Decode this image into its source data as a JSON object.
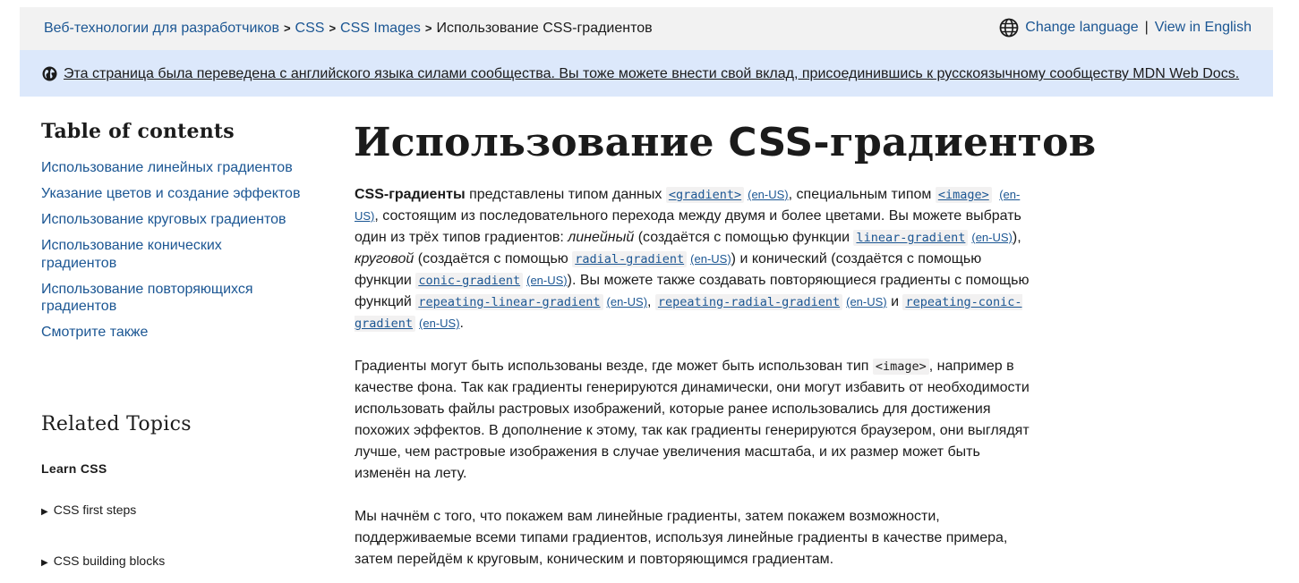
{
  "breadcrumbs": {
    "items": [
      "Веб-технологии для разработчиков",
      "CSS",
      "CSS Images"
    ],
    "current": "Использование CSS-градиентов",
    "separator": ">"
  },
  "language": {
    "change_label": "Change language",
    "divider": "|",
    "view_english": "View in English"
  },
  "notice": {
    "text": "Эта страница была переведена с английского языка силами сообщества. Вы тоже можете внести свой вклад, присоединившись к русскоязычному сообществу MDN Web Docs."
  },
  "toc": {
    "title": "Table of contents",
    "items": [
      "Использование линейных градиентов",
      "Указание цветов и создание эффектов",
      "Использование круговых градиентов",
      "Использование конических градиентов",
      "Использование повторяющихся градиентов",
      "Смотрите также"
    ]
  },
  "related": {
    "title": "Related Topics",
    "learn_css": "Learn CSS",
    "groups": [
      "CSS first steps",
      "CSS building blocks"
    ]
  },
  "article": {
    "title_part1": "Использование ",
    "title_css": "CSS",
    "title_part2": "-градиентов",
    "p1": {
      "bold": "CSS-градиенты",
      "t1": " представлены типом данных ",
      "code1": "<gradient>",
      "enus": "(en-US)",
      "t2": ", специальным типом ",
      "code2": "<image>",
      "t3": ", состоящим из последовательного перехода между двумя и более цветами. Вы можете выбрать один из трёх типов градиентов: ",
      "em1": "линейный",
      "t4": " (создаётся с помощью функции ",
      "code3": "linear-gradient",
      "t5": "), ",
      "em2": "круговой",
      "t6": " (создаётся с помощью ",
      "code4": "radial-gradient",
      "t7": ") и конический (создаётся с помощью функции ",
      "code5": "conic-gradient",
      "t8": "). Вы можете также создавать повторяющиеся градиенты с помощью функций ",
      "code6": "repeating-linear-gradient",
      "comma": ", ",
      "code7": "repeating-radial-gradient",
      "and": " и ",
      "code8": "repeating-conic-gradient",
      "end": "."
    },
    "p2": {
      "t1": "Градиенты могут быть использованы везде, где может быть использован тип ",
      "code": "<image>",
      "t2": ", например в качестве фона. Так как градиенты генерируются динамически, они могут избавить от необходимости использовать файлы растровых изображений, которые ранее использовались для достижения похожих эффектов. В дополнение к этому, так как градиенты генерируются браузером, они выглядят лучше, чем растровые изображения в случае увеличения масштаба, и их размер может быть изменён на лету."
    },
    "p3": "Мы начнём с того, что покажем вам линейные градиенты, затем покажем возможности, поддерживаемые всеми типами градиентов, используя линейные градиенты в качестве примера, затем перейдём к круговым, коническим и повторяющимся градиентам."
  },
  "colors": {
    "link": "#1b5693",
    "topbar_bg": "#f2f2f2",
    "notice_bg": "#dce8fb",
    "text": "#1b1b1b",
    "code_bg": "#f2f1f1"
  },
  "icons": {
    "language": "globe-icon",
    "notice": "globe-filled-icon",
    "disclosure": "triangle-right-icon"
  }
}
